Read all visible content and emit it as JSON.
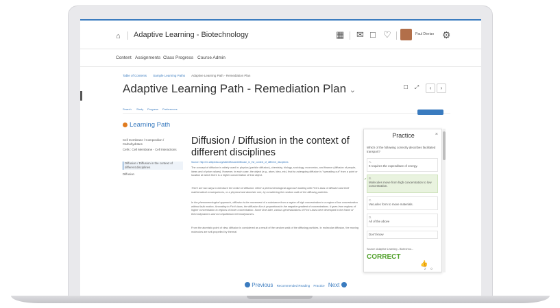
{
  "topbar": {
    "course_title": "Adaptive Learning - Biotechnology",
    "user_name": "Paul Dierian",
    "icons": [
      "home-icon",
      "grid-icon",
      "mail-icon",
      "chat-icon",
      "bell-icon",
      "gear-icon"
    ]
  },
  "nav": {
    "items": [
      "Content",
      "Assignments",
      "Class Progress",
      "Course Admin"
    ]
  },
  "breadcrumbs": [
    "Table of Contents",
    "Sample Learning Paths",
    "Adaptive Learning Path - Remediation Plan"
  ],
  "page_title": "Adaptive Learning Path - Remediation Plan",
  "inner_toolbar": {
    "left": [
      "Search",
      "Study",
      "Progress",
      "Preferences"
    ]
  },
  "learning_path": {
    "heading": "Learning Path",
    "items": [
      "Cell membrane / Composition / Carbohydrates",
      "Cells : Cell Membrane - Cell Interactions",
      "Diffusion / Diffusion in the context of different disciplines",
      "Diffusion"
    ]
  },
  "doc": {
    "title": "Diffusion / Diffusion in the context of different disciplines",
    "source": "Source: http://en.wikipedia.org/wiki/Diffusion#Diffusion_in_the_context_of_different_disciplines",
    "paragraphs": [
      "The concept of diffusion is widely used in: physics (particle diffusion), chemistry, biology, sociology, economics, and finance (diffusion of people, ideas and of price values). However, in each case, the object (e.g., atom, idea, etc.) that is undergoing diffusion is \"spreading out\" from a point or location at which there is a higher concentration of that object.",
      "There are two ways to introduce the notion of diffusion: either a phenomenological approach starting with Fick's laws of diffusion and their mathematical consequences, or a physical and atomistic one, by considering the random walk of the diffusing particles.",
      "In the phenomenological approach, diffusion is the movement of a substance from a region of high concentration to a region of low concentration without bulk motion. According to Fick's laws, the diffusion flux is proportional to the negative gradient of concentrations. It goes from regions of higher concentration to regions of lower concentration. Some time later, various generalizations of Fick's laws were developed in the frame of thermodynamics and non-equilibrium thermodynamics.",
      "From the atomistic point of view, diffusion is considered as a result of the random walk of the diffusing particles. In molecular diffusion, the moving molecules are self-propelled by thermal"
    ]
  },
  "footer_nav": {
    "previous": "Previous",
    "recommended": "Recommended Reading",
    "practice": "Practice",
    "next": "Next"
  },
  "practice": {
    "title": "Practice",
    "close": "×",
    "question": "Which of the following correctly describes facilitated transport?",
    "options": [
      {
        "letter": "A.",
        "text": "It requires the expenditure of energy."
      },
      {
        "letter": "B.",
        "text": "Molecules move from high concentration to low concentration."
      },
      {
        "letter": "C.",
        "text": "Vacuoles form to move materials."
      },
      {
        "letter": "D.",
        "text": "All of the above"
      },
      {
        "letter": "",
        "text": "Don't know"
      }
    ],
    "source": "Source: Adaptive Learning - Biotechno...",
    "result": "CORRECT",
    "votes_up": "2",
    "votes_down": "0"
  }
}
